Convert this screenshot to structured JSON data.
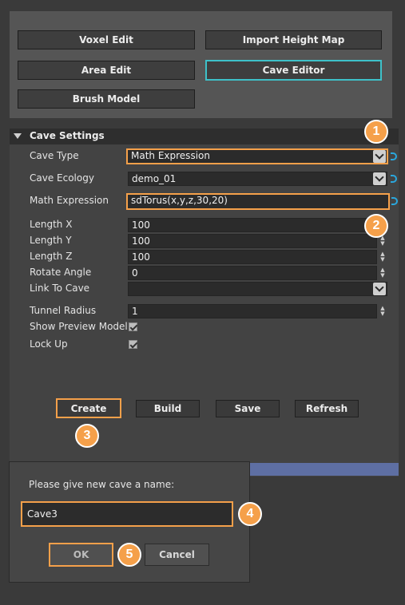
{
  "toolbar": {
    "voxel_edit": "Voxel Edit",
    "import_height_map": "Import Height Map",
    "area_edit": "Area Edit",
    "cave_editor": "Cave Editor",
    "brush_model": "Brush Model"
  },
  "cave_settings": {
    "title": "Cave Settings",
    "cave_type": {
      "label": "Cave Type",
      "value": "Math Expression"
    },
    "cave_ecology": {
      "label": "Cave Ecology",
      "value": "demo_01"
    },
    "math_expression": {
      "label": "Math Expression",
      "value": "sdTorus(x,y,z,30,20)"
    },
    "length_x": {
      "label": "Length X",
      "value": "100"
    },
    "length_y": {
      "label": "Length Y",
      "value": "100"
    },
    "length_z": {
      "label": "Length Z",
      "value": "100"
    },
    "rotate_angle": {
      "label": "Rotate Angle",
      "value": "0"
    },
    "link_to_cave": {
      "label": "Link To Cave",
      "value": ""
    },
    "tunnel_radius": {
      "label": "Tunnel Radius",
      "value": "1"
    },
    "show_preview_model": {
      "label": "Show Preview Model",
      "checked": true
    },
    "lock_up": {
      "label": "Lock Up",
      "checked": true
    }
  },
  "actions": {
    "create": "Create",
    "build": "Build",
    "save": "Save",
    "refresh": "Refresh"
  },
  "dialog": {
    "prompt": "Please give new cave a name:",
    "name_value": "Cave3",
    "ok": "OK",
    "cancel": "Cancel"
  },
  "badges": [
    "1",
    "2",
    "3",
    "4",
    "5"
  ],
  "colors": {
    "highlight": "#f5a04a",
    "active_tab": "#3ec1c9",
    "link_icon": "#2aa7dd"
  }
}
